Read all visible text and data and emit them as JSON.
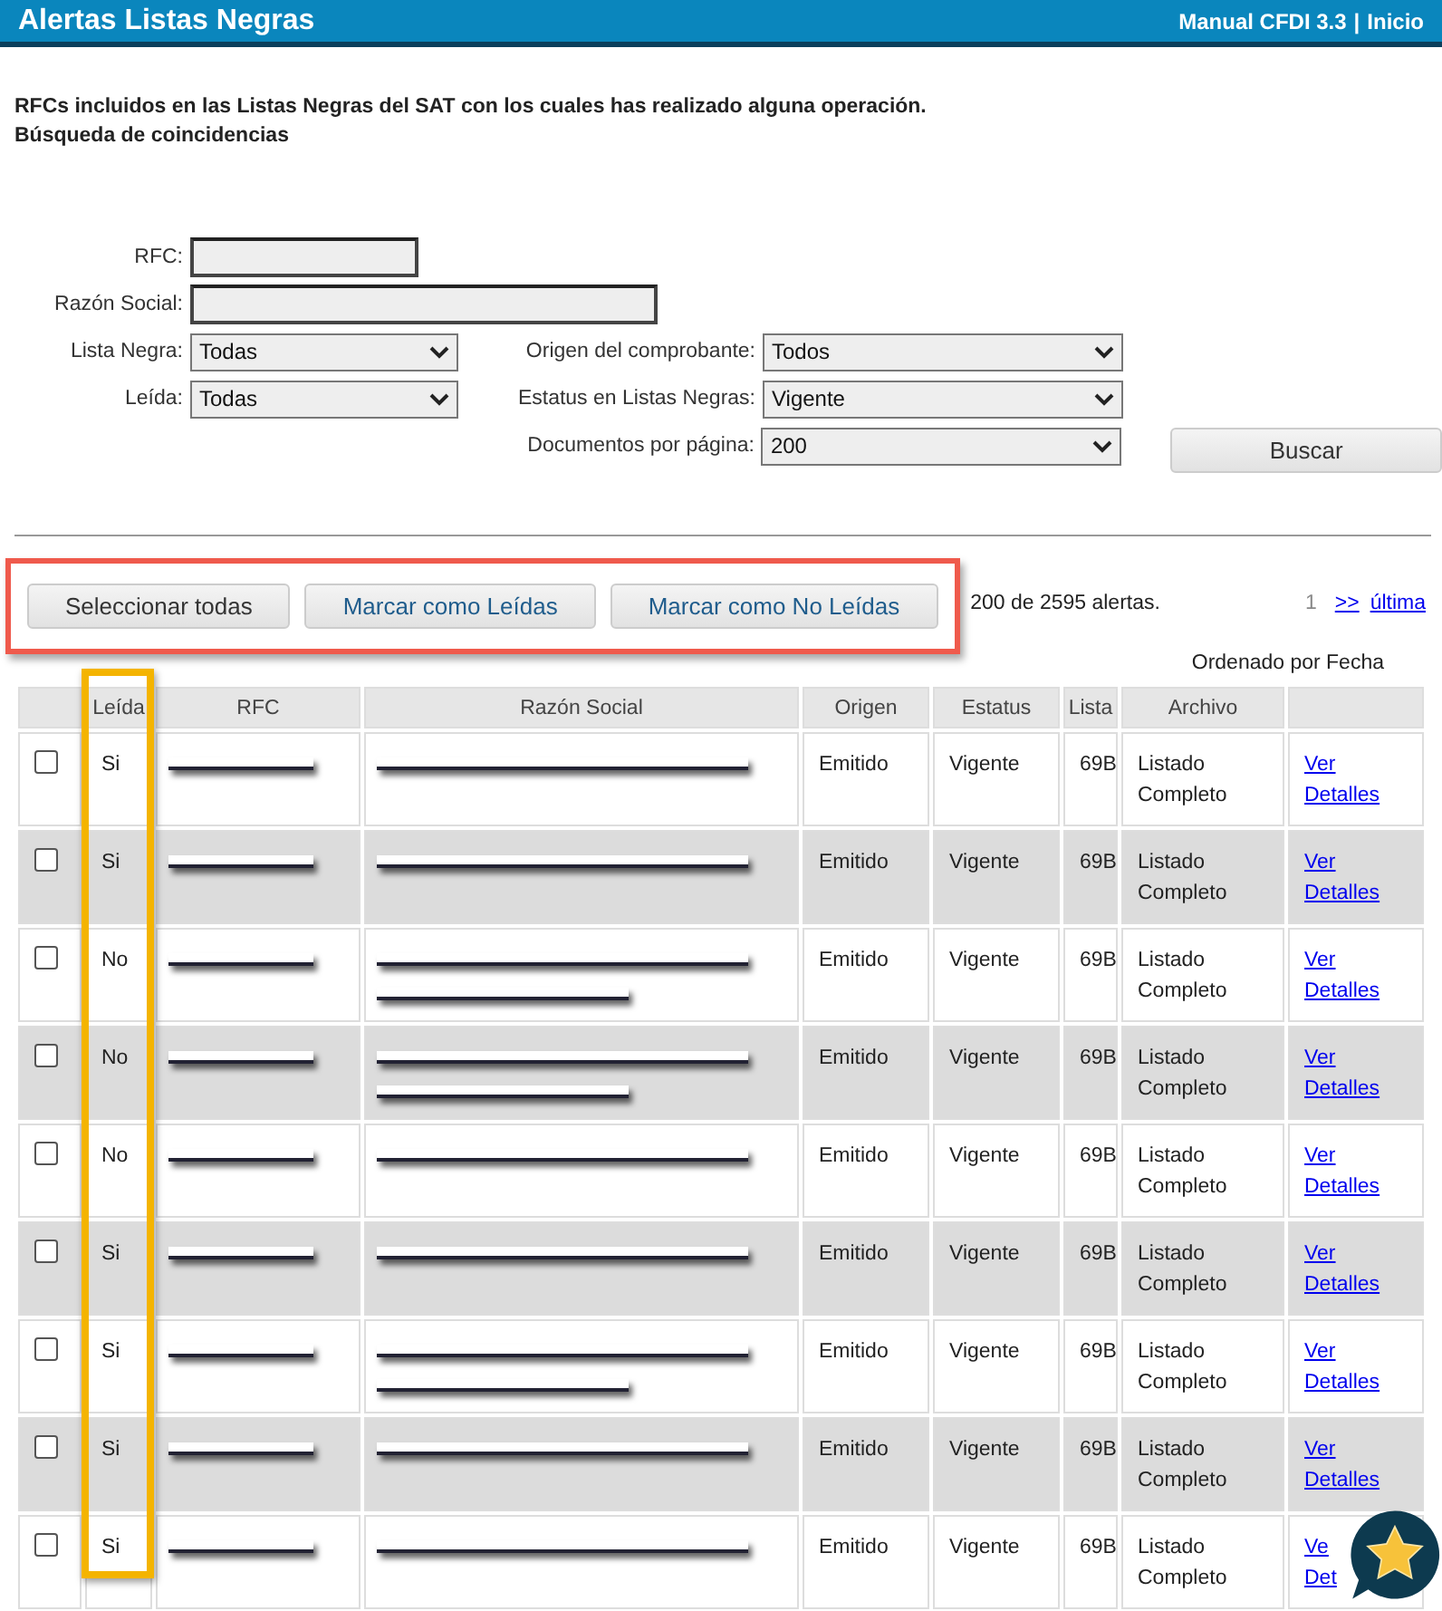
{
  "header": {
    "title": "Alertas Listas Negras",
    "links": [
      "Manual CFDI 3.3",
      "|",
      "Inicio"
    ]
  },
  "intro": [
    "RFCs incluidos en las Listas Negras del SAT con los cuales has realizado alguna operación.",
    "Búsqueda de coincidencias"
  ],
  "form": {
    "rfc_label": "RFC:",
    "razon_social_label": "Razón Social:",
    "lista_negra": {
      "label": "Lista Negra:",
      "value": "Todas"
    },
    "leida": {
      "label": "Leída:",
      "value": "Todas"
    },
    "origen": {
      "label": "Origen del comprobante:",
      "value": "Todos"
    },
    "estatus": {
      "label": "Estatus en Listas Negras:",
      "value": "Vigente"
    },
    "documentos": {
      "label": "Documentos por página:",
      "value": "200"
    },
    "search_button": "Buscar"
  },
  "actions": {
    "highlighted": true,
    "buttons": [
      "Seleccionar todas",
      "Marcar como Leídas",
      "Marcar como No Leídas"
    ],
    "count": "200 de 2595 alertas.",
    "pagination": {
      "current": "1",
      "next": ">>",
      "last": "última"
    }
  },
  "sort_note": "Ordenado por Fecha",
  "table": {
    "columns": [
      "Leída",
      "RFC",
      "Razón Social",
      "Origen",
      "Estatus",
      "Lista",
      "Archivo"
    ],
    "leida_highlighted": true,
    "rows": [
      {
        "selected": false,
        "leida": "Si",
        "rfc": {
          "kind": "redacted"
        },
        "razon_social": {
          "kind": "redacted",
          "wrapped": false
        },
        "origen": "Emitido",
        "estatus": "Vigente",
        "lista": "69B",
        "archivo": "Listado Completo",
        "link": [
          "Ver",
          "Detalles"
        ]
      },
      {
        "selected": false,
        "leida": "Si",
        "rfc": {
          "kind": "redacted"
        },
        "razon_social": {
          "kind": "redacted",
          "wrapped": false
        },
        "origen": "Emitido",
        "estatus": "Vigente",
        "lista": "69B",
        "archivo": "Listado Completo",
        "link": [
          "Ver",
          "Detalles"
        ]
      },
      {
        "selected": false,
        "leida": "No",
        "rfc": {
          "kind": "redacted"
        },
        "razon_social": {
          "kind": "redacted",
          "wrapped": true
        },
        "origen": "Emitido",
        "estatus": "Vigente",
        "lista": "69B",
        "archivo": "Listado Completo",
        "link": [
          "Ver",
          "Detalles"
        ]
      },
      {
        "selected": false,
        "leida": "No",
        "rfc": {
          "kind": "redacted"
        },
        "razon_social": {
          "kind": "redacted",
          "wrapped": true
        },
        "origen": "Emitido",
        "estatus": "Vigente",
        "lista": "69B",
        "archivo": "Listado Completo",
        "link": [
          "Ver",
          "Detalles"
        ]
      },
      {
        "selected": false,
        "leida": "No",
        "rfc": {
          "kind": "redacted"
        },
        "razon_social": {
          "kind": "redacted",
          "wrapped": false
        },
        "origen": "Emitido",
        "estatus": "Vigente",
        "lista": "69B",
        "archivo": "Listado Completo",
        "link": [
          "Ver",
          "Detalles"
        ]
      },
      {
        "selected": false,
        "leida": "Si",
        "rfc": {
          "kind": "redacted"
        },
        "razon_social": {
          "kind": "redacted",
          "wrapped": false
        },
        "origen": "Emitido",
        "estatus": "Vigente",
        "lista": "69B",
        "archivo": "Listado Completo",
        "link": [
          "Ver",
          "Detalles"
        ]
      },
      {
        "selected": false,
        "leida": "Si",
        "rfc": {
          "kind": "redacted"
        },
        "razon_social": {
          "kind": "redacted",
          "wrapped": true
        },
        "origen": "Emitido",
        "estatus": "Vigente",
        "lista": "69B",
        "archivo": "Listado Completo",
        "link": [
          "Ver",
          "Detalles"
        ]
      },
      {
        "selected": false,
        "leida": "Si",
        "rfc": {
          "kind": "redacted"
        },
        "razon_social": {
          "kind": "redacted",
          "wrapped": false
        },
        "origen": "Emitido",
        "estatus": "Vigente",
        "lista": "69B",
        "archivo": "Listado Completo",
        "link": [
          "Ver",
          "Detalles"
        ]
      },
      {
        "selected": false,
        "leida": "Si",
        "rfc": {
          "kind": "redacted"
        },
        "razon_social": {
          "kind": "redacted",
          "wrapped": false
        },
        "origen": "Emitido",
        "estatus": "Vigente",
        "lista": "69B",
        "archivo": "Listado Completo",
        "link": [
          "Ve",
          "Det"
        ]
      }
    ]
  },
  "badge": {
    "kind": "star"
  }
}
